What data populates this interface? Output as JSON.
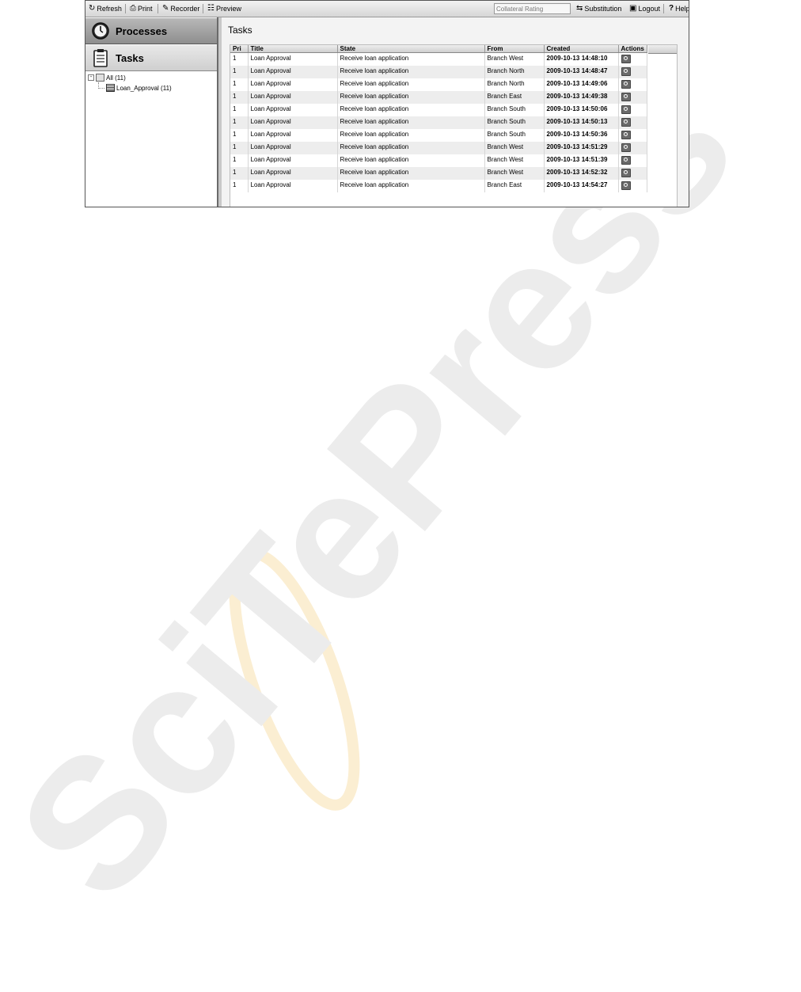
{
  "toolbar": {
    "refresh": "Refresh",
    "print": "Print",
    "recorder": "Recorder",
    "preview": "Preview",
    "search_placeholder": "Collateral Rating",
    "substitution": "Substitution",
    "logout": "Logout",
    "help": "Help"
  },
  "nav": {
    "processes": "Processes",
    "tasks": "Tasks"
  },
  "tree": {
    "all": "All (11)",
    "loan_approval": "Loan_Approval (11)"
  },
  "main": {
    "title": "Tasks"
  },
  "table": {
    "headers": {
      "pri": "Pri",
      "title": "Title",
      "state": "State",
      "from": "From",
      "created": "Created",
      "actions": "Actions"
    },
    "rows": [
      {
        "pri": "1",
        "title": "Loan Approval",
        "state": "Receive loan application",
        "from": "Branch West",
        "created": "2009-10-13 14:48:10"
      },
      {
        "pri": "1",
        "title": "Loan Approval",
        "state": "Receive loan application",
        "from": "Branch North",
        "created": "2009-10-13 14:48:47"
      },
      {
        "pri": "1",
        "title": "Loan Approval",
        "state": "Receive loan application",
        "from": "Branch North",
        "created": "2009-10-13 14:49:06"
      },
      {
        "pri": "1",
        "title": "Loan Approval",
        "state": "Receive loan application",
        "from": "Branch East",
        "created": "2009-10-13 14:49:38"
      },
      {
        "pri": "1",
        "title": "Loan Approval",
        "state": "Receive loan application",
        "from": "Branch South",
        "created": "2009-10-13 14:50:06"
      },
      {
        "pri": "1",
        "title": "Loan Approval",
        "state": "Receive loan application",
        "from": "Branch South",
        "created": "2009-10-13 14:50:13"
      },
      {
        "pri": "1",
        "title": "Loan Approval",
        "state": "Receive loan application",
        "from": "Branch South",
        "created": "2009-10-13 14:50:36"
      },
      {
        "pri": "1",
        "title": "Loan Approval",
        "state": "Receive loan application",
        "from": "Branch West",
        "created": "2009-10-13 14:51:29"
      },
      {
        "pri": "1",
        "title": "Loan Approval",
        "state": "Receive loan application",
        "from": "Branch West",
        "created": "2009-10-13 14:51:39"
      },
      {
        "pri": "1",
        "title": "Loan Approval",
        "state": "Receive loan application",
        "from": "Branch West",
        "created": "2009-10-13 14:52:32"
      },
      {
        "pri": "1",
        "title": "Loan Approval",
        "state": "Receive loan application",
        "from": "Branch East",
        "created": "2009-10-13 14:54:27"
      }
    ],
    "action_icon": "magnifier-icon"
  },
  "watermark": {
    "text": "SciTePress"
  },
  "colors": {
    "processes_tab": "#a3a3a3",
    "tasks_tab": "#dcdcdc",
    "watermark": "#ececec",
    "watermark_ring": "#fbeed2"
  }
}
